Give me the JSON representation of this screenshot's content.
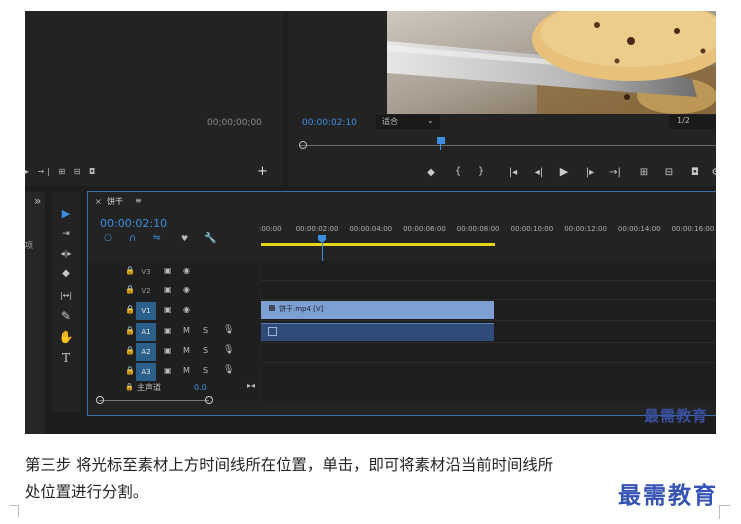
{
  "left_panel": {
    "timecode": "00;00;00;00"
  },
  "program": {
    "timecode": "00:00:02:10",
    "fit_label": "适合",
    "resolution": "1/2"
  },
  "toolbar_marks": {
    "left_brace": "{",
    "right_brace": "}"
  },
  "project_panel": {
    "chevron": "»",
    "label": "项"
  },
  "timeline": {
    "tab_title": "饼干",
    "menu_glyph": "≡",
    "timecode": "00:00:02:10",
    "ruler_ticks": [
      ":00:00",
      "00:00:02:00",
      "00:00:04:00",
      "00:00:06:00",
      "00:00:08:00",
      "00:00:10:00",
      "00:00:12:00",
      "00:00:14:00",
      "00:00:16:00"
    ],
    "tracks": [
      {
        "name": "V3",
        "type": "video"
      },
      {
        "name": "V2",
        "type": "video"
      },
      {
        "name": "V1",
        "type": "video"
      },
      {
        "name": "A1",
        "type": "audio"
      },
      {
        "name": "A2",
        "type": "audio"
      },
      {
        "name": "A3",
        "type": "audio"
      }
    ],
    "mute_label": "M",
    "solo_label": "S",
    "master_label": "主声道",
    "master_value": "0.0",
    "clip_label": "饼干.mp4 [V]"
  },
  "tools": [
    "▶",
    "⇥",
    "◂|▸",
    "◆",
    "|↔|",
    "✎",
    "✋",
    "T"
  ],
  "watermark_small": "最需教育",
  "watermark_large": "最需教育",
  "caption": {
    "line1": "第三步  将光标至素材上方时间线所在位置，单击，即可将素材沿当前时间线所",
    "line2": "处位置进行分割。"
  },
  "colors": {
    "accent_blue": "#3c8fe0",
    "clip_blue": "#7e9fd1",
    "work_area_yellow": "#e5d31c"
  }
}
